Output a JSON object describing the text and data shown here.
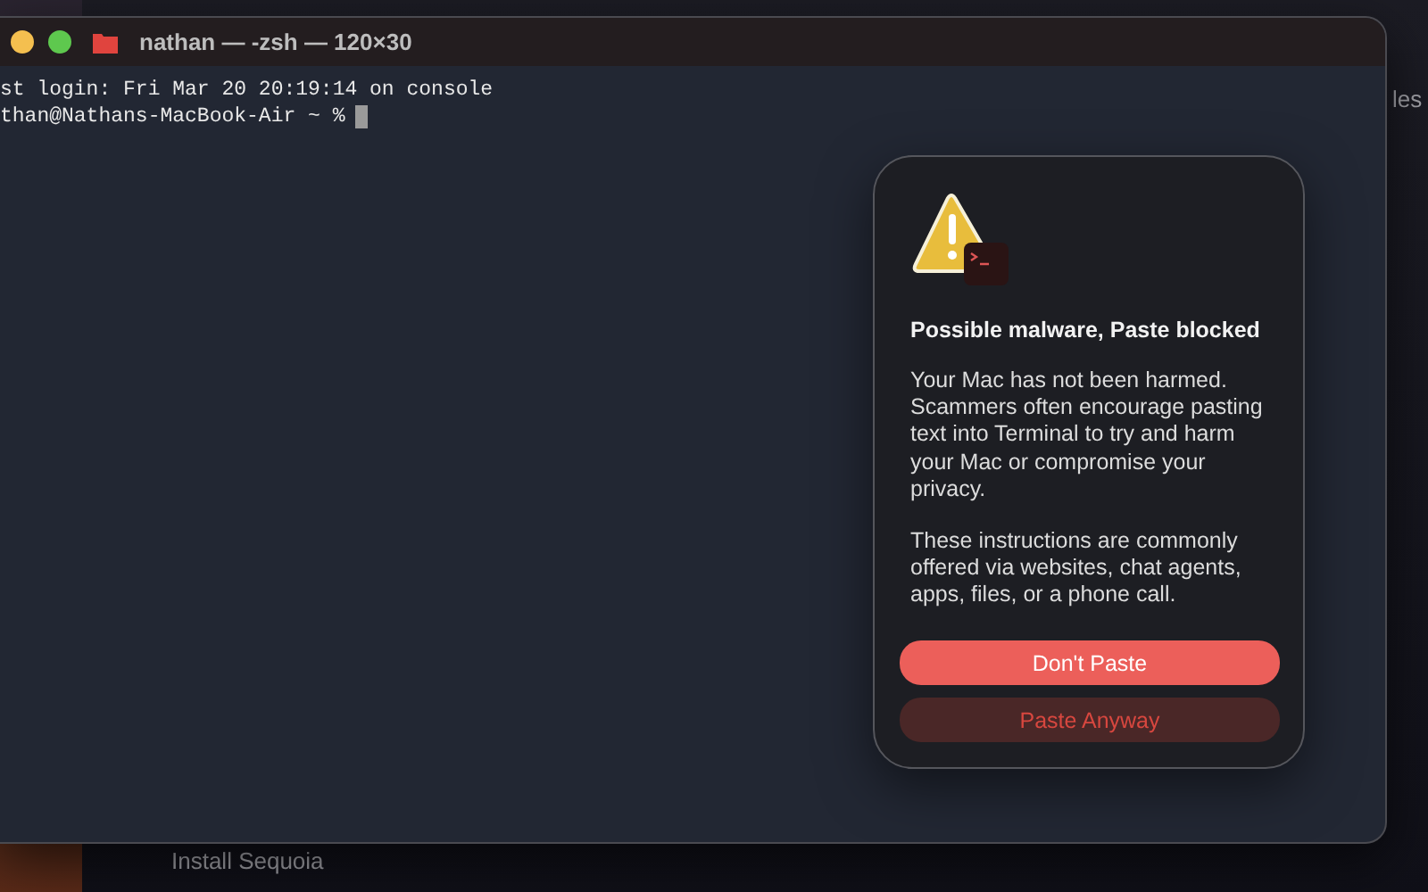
{
  "desktop": {
    "background_texts": [
      {
        "text": "les"
      },
      {
        "text": "Install Sequoia"
      }
    ]
  },
  "window": {
    "title": "nathan — -zsh — 120×30",
    "controls": [
      {
        "kind": "minimize"
      },
      {
        "kind": "zoom"
      }
    ]
  },
  "terminal": {
    "lines": [
      "st login: Fri Mar 20 20:19:14 on console",
      "than@Nathans-MacBook-Air ~ %"
    ],
    "cursor": true
  },
  "alert": {
    "title": "Possible malware, Paste blocked",
    "paragraphs": [
      "Your Mac has not been harmed. Scammers often encourage pasting text into Terminal to try and harm your Mac or compromise your privacy.",
      "These instructions are commonly offered via websites, chat agents, apps, files, or a phone call."
    ],
    "buttons": [
      {
        "label": "Don't Paste",
        "kind": "primary"
      },
      {
        "label": "Paste Anyway",
        "kind": "destructive"
      }
    ]
  }
}
